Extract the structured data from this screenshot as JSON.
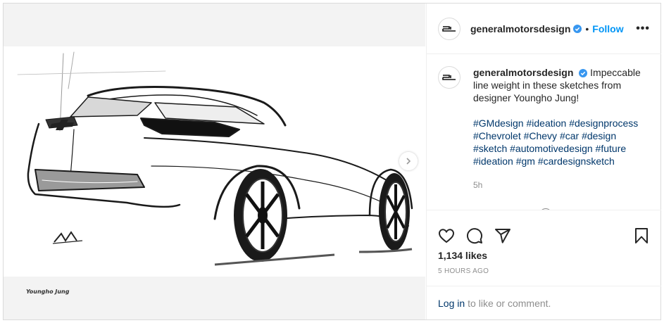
{
  "post": {
    "username": "generalmotorsdesign",
    "follow_label": "Follow",
    "dot": "•",
    "more_label": "•••",
    "caption": "Impeccable line weight in these sketches from designer Youngho Jung!",
    "hashtags": "#GMdesign #ideation #designprocess #Chevrolet #Chevy #car #design #sketch #automotivedesign #future #ideation #gm #cardesignsketch",
    "caption_time": "5h",
    "likes": "1,134 likes",
    "timestamp": "5 HOURS AGO",
    "login_link": "Log in",
    "login_suffix": "to like or comment."
  },
  "media": {
    "signature": "Youngho Jung"
  },
  "colors": {
    "link_blue": "#0095f6",
    "hashtag": "#00376b",
    "muted": "#8e8e8e",
    "verified": "#3897f0"
  }
}
